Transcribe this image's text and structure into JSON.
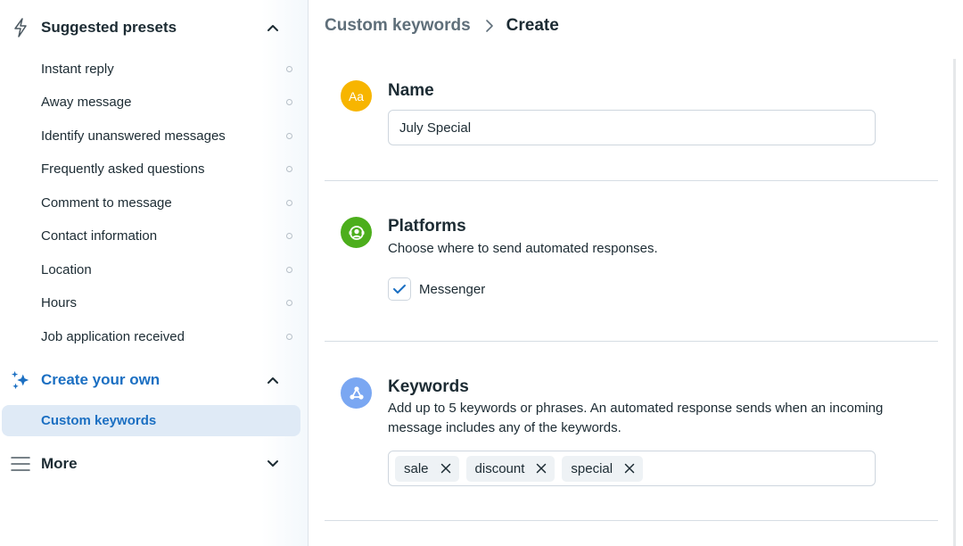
{
  "sidebar": {
    "suggested": {
      "label": "Suggested presets",
      "icon": "lightning-icon",
      "expanded": true,
      "items": [
        {
          "label": "Instant reply"
        },
        {
          "label": "Away message"
        },
        {
          "label": "Identify unanswered messages"
        },
        {
          "label": "Frequently asked questions"
        },
        {
          "label": "Comment to message"
        },
        {
          "label": "Contact information"
        },
        {
          "label": "Location"
        },
        {
          "label": "Hours"
        },
        {
          "label": "Job application received"
        }
      ]
    },
    "create_own": {
      "label": "Create your own",
      "icon": "sparkle-icon",
      "expanded": true,
      "items": [
        {
          "label": "Custom keywords",
          "active": true
        }
      ]
    },
    "more": {
      "label": "More",
      "icon": "menu-icon",
      "expanded": false
    }
  },
  "breadcrumb": {
    "parent": "Custom keywords",
    "current": "Create"
  },
  "form": {
    "name": {
      "title": "Name",
      "icon_text": "Aa",
      "icon_color": "#f7b500",
      "value": "July Special"
    },
    "platforms": {
      "title": "Platforms",
      "description": "Choose where to send automated responses.",
      "icon_color": "#4cae1c",
      "options": [
        {
          "label": "Messenger",
          "checked": true
        }
      ]
    },
    "keywords": {
      "title": "Keywords",
      "description": "Add up to 5 keywords or phrases. An automated response sends when an incoming message includes any of the keywords.",
      "icon_color": "#7aa7f2",
      "tags": [
        "sale",
        "discount",
        "special"
      ]
    }
  },
  "colors": {
    "accent_blue": "#1b6fc2",
    "active_bg": "#dfeaf6",
    "text_primary": "#1c2b33",
    "text_secondary": "#5f6f7a"
  }
}
